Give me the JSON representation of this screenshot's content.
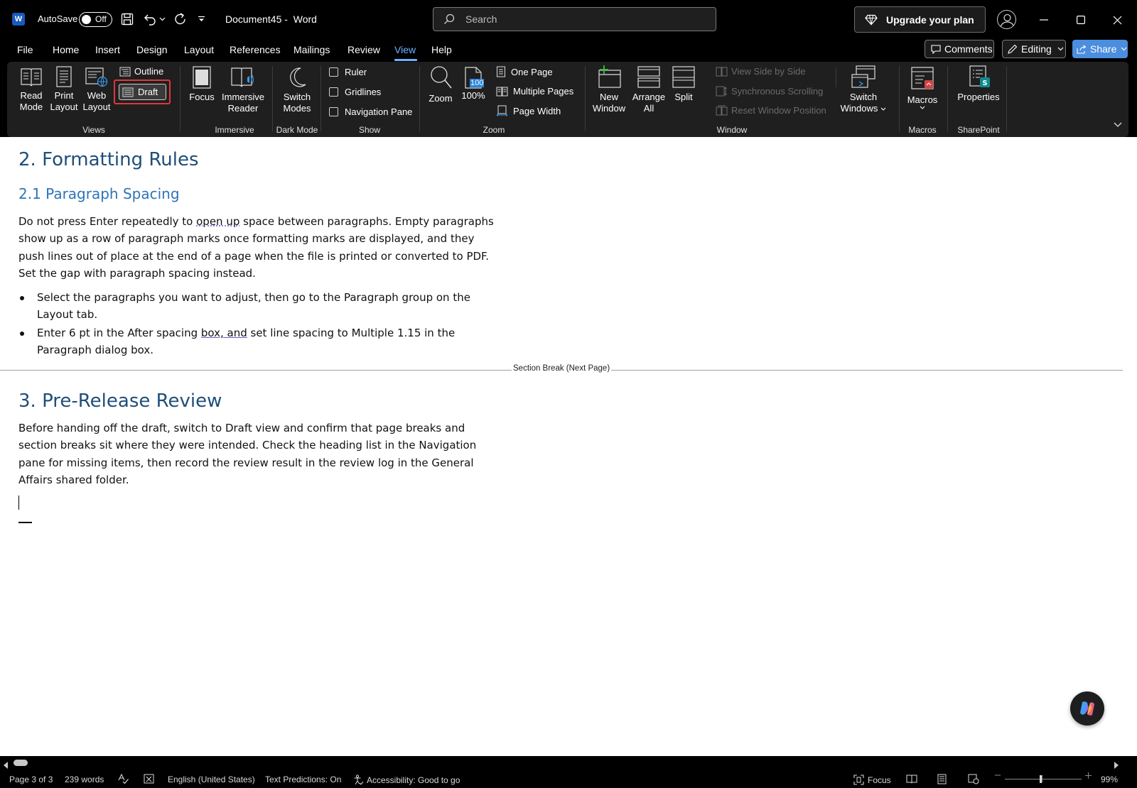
{
  "app": {
    "autosave_label": "AutoSave",
    "autosave_state": "Off",
    "doc_name": "Document45",
    "app_name": "Word",
    "title_separator": "-"
  },
  "search": {
    "placeholder": "Search"
  },
  "header": {
    "upgrade_label": "Upgrade your plan",
    "comments_label": "Comments",
    "editing_label": "Editing",
    "share_label": "Share"
  },
  "tabs": [
    {
      "label": "File"
    },
    {
      "label": "Home"
    },
    {
      "label": "Insert"
    },
    {
      "label": "Design"
    },
    {
      "label": "Layout"
    },
    {
      "label": "References"
    },
    {
      "label": "Mailings"
    },
    {
      "label": "Review"
    },
    {
      "label": "View"
    },
    {
      "label": "Help"
    }
  ],
  "active_tab": "View",
  "ribbon": {
    "views": {
      "group_label": "Views",
      "read_mode": [
        "Read",
        "Mode"
      ],
      "print_layout": [
        "Print",
        "Layout"
      ],
      "web_layout": [
        "Web",
        "Layout"
      ],
      "outline": "Outline",
      "draft": "Draft"
    },
    "immersive": {
      "group_label": "Immersive",
      "focus": "Focus",
      "immersive_reader": [
        "Immersive",
        "Reader"
      ]
    },
    "dark_mode": {
      "group_label": "Dark Mode",
      "switch_modes": [
        "Switch",
        "Modes"
      ]
    },
    "show": {
      "group_label": "Show",
      "ruler": "Ruler",
      "gridlines": "Gridlines",
      "navigation_pane": "Navigation Pane"
    },
    "zoom": {
      "group_label": "Zoom",
      "zoom": "Zoom",
      "hundred": "100%",
      "hundred_icon": "100",
      "one_page": "One Page",
      "multiple_pages": "Multiple Pages",
      "page_width": "Page Width"
    },
    "window": {
      "group_label": "Window",
      "new_window": [
        "New",
        "Window"
      ],
      "arrange_all": [
        "Arrange",
        "All"
      ],
      "split": "Split",
      "view_side_by_side": "View Side by Side",
      "synchronous_scrolling": "Synchronous Scrolling",
      "reset_window_position": "Reset Window Position",
      "switch_windows": [
        "Switch",
        "Windows"
      ]
    },
    "macros": {
      "group_label": "Macros",
      "macros": "Macros"
    },
    "sharepoint": {
      "group_label": "SharePoint",
      "properties": "Properties"
    }
  },
  "document": {
    "h1_formatting": "2. Formatting Rules",
    "h2_spacing": "2.1 Paragraph Spacing",
    "p1_a": "Do not press Enter repeatedly to ",
    "p1_squiggle": "open up",
    "p1_b": " space between paragraphs. Empty paragraphs show up as a row of paragraph marks once formatting marks are displayed, and they push lines out of place at the end of a page when the file is printed or converted to PDF. Set the gap with paragraph spacing instead.",
    "bullet1": "Select the paragraphs you want to adjust, then go to the Paragraph group on the Layout tab.",
    "bullet2_a": "Enter 6 pt in the After spacing ",
    "bullet2_squiggle": "box, and",
    "bullet2_b": " set line spacing to Multiple 1.15 in the Paragraph dialog box.",
    "section_break": "Section Break (Next Page)",
    "h1_review": "3. Pre-Release Review",
    "p2": "Before handing off the draft, switch to Draft view and confirm that page breaks and section breaks sit where they were intended. Check the heading list in the Navigation pane for missing items, then record the review result in the review log in the General Affairs shared folder."
  },
  "status": {
    "page": "Page 3 of 3",
    "words": "239 words",
    "language": "English (United States)",
    "text_predictions": "Text Predictions: On",
    "accessibility": "Accessibility: Good to go",
    "focus": "Focus",
    "zoom_level": "99%"
  },
  "colors": {
    "accent": "#6fb1ff",
    "share_blue": "#4c8dde",
    "highlight_red": "#e0373b",
    "heading1": "#1f4e79",
    "heading2": "#2e74b5"
  }
}
